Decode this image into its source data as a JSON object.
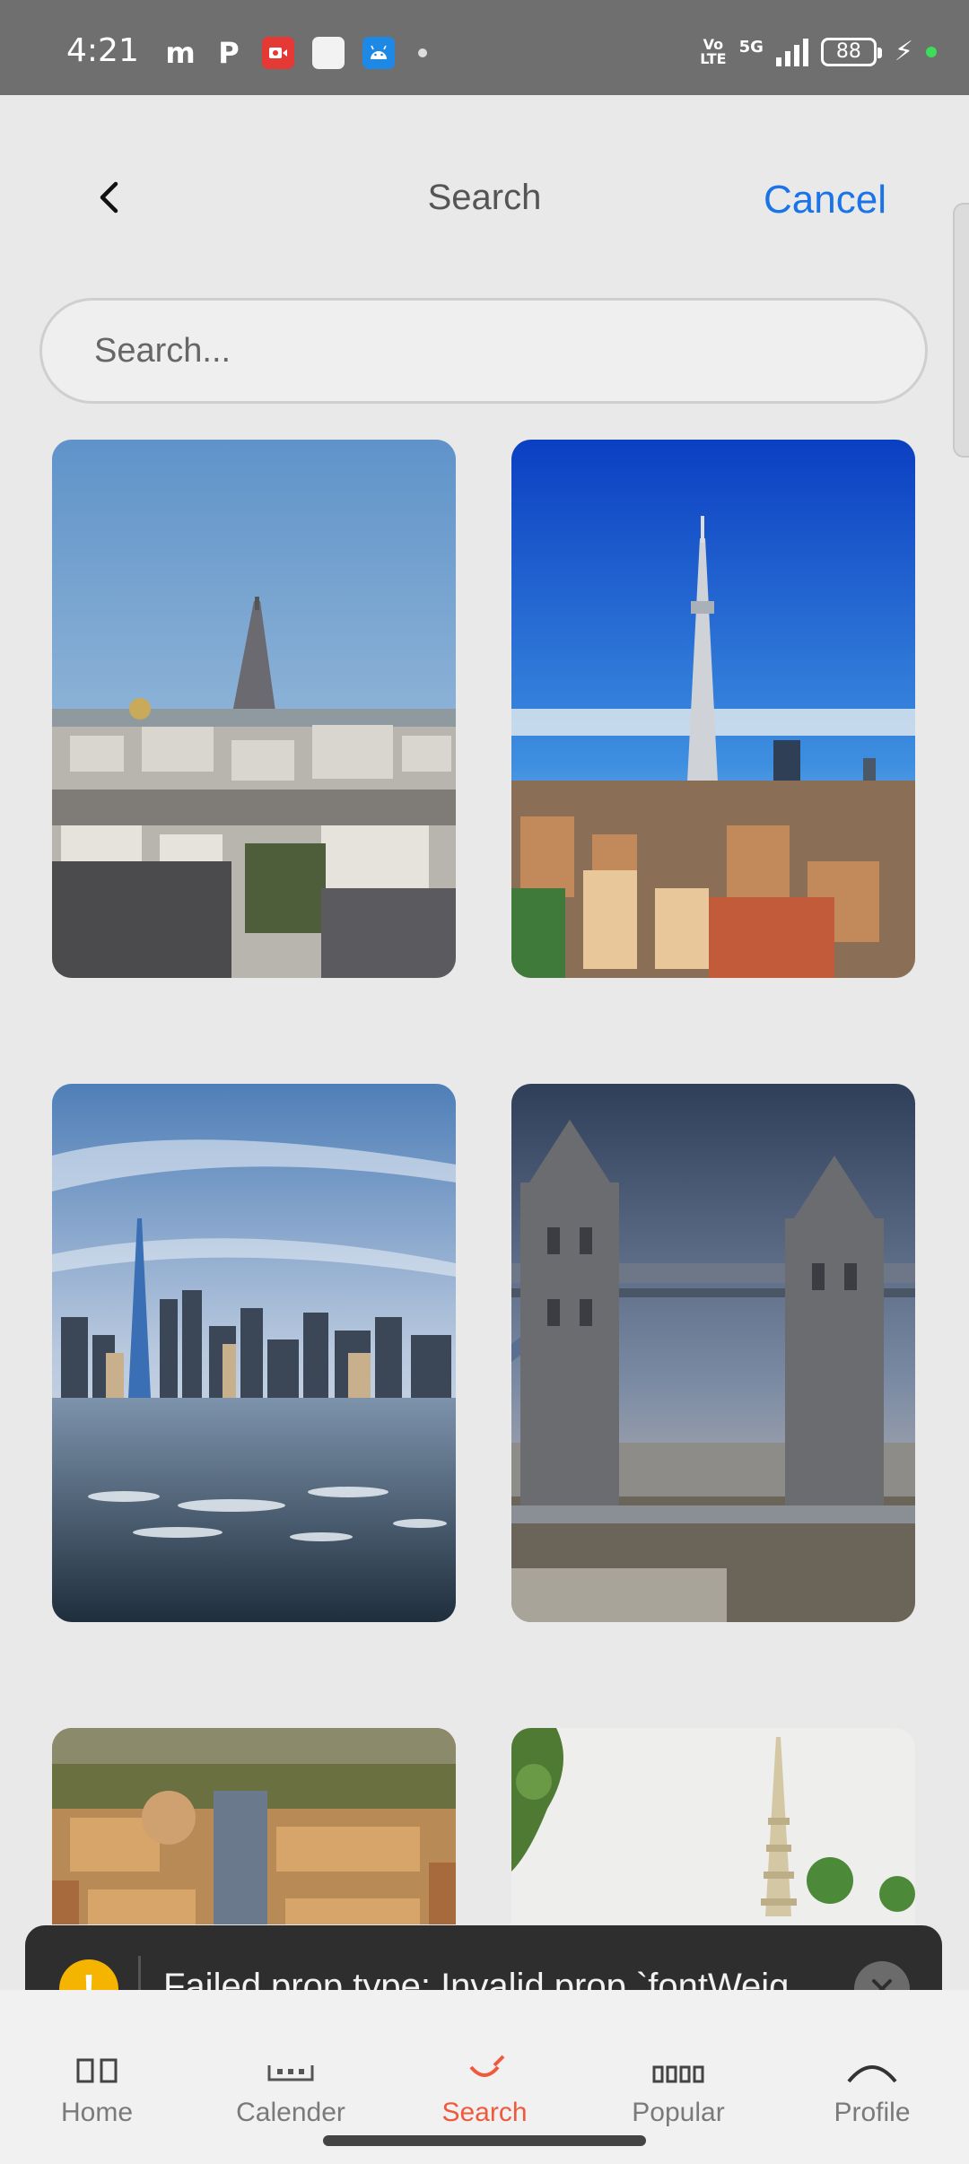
{
  "status_bar": {
    "time": "4:21",
    "left_icons": [
      "m",
      "P"
    ],
    "app_icons": [
      "video-recorder-icon",
      "white-app-icon",
      "android-icon"
    ],
    "volte_top": "Vo",
    "volte_bottom": "LTE",
    "network": "5G",
    "battery": "88"
  },
  "header": {
    "title": "Search",
    "cancel_label": "Cancel"
  },
  "search": {
    "placeholder": "Search..."
  },
  "grid": {
    "images": [
      {
        "id": "paris",
        "icon": "eiffel-tower-photo"
      },
      {
        "id": "tokyo",
        "icon": "tokyo-skytree-photo"
      },
      {
        "id": "new-york",
        "icon": "new-york-skyline-photo"
      },
      {
        "id": "london",
        "icon": "tower-bridge-photo"
      },
      {
        "id": "rome",
        "icon": "rome-aerial-photo"
      },
      {
        "id": "bangkok",
        "icon": "stupa-photo"
      }
    ]
  },
  "toast": {
    "message": "Failed prop type: Invalid prop `fontWeig...",
    "icon": "warning-icon"
  },
  "bottom_nav": {
    "items": [
      {
        "label": "Home"
      },
      {
        "label": "Calender"
      },
      {
        "label": "Search"
      },
      {
        "label": "Popular"
      },
      {
        "label": "Profile"
      }
    ],
    "active_index": 2
  },
  "colors": {
    "accent": "#1a73e8",
    "active_tab": "#f05a3c",
    "warning": "#f5b400"
  }
}
